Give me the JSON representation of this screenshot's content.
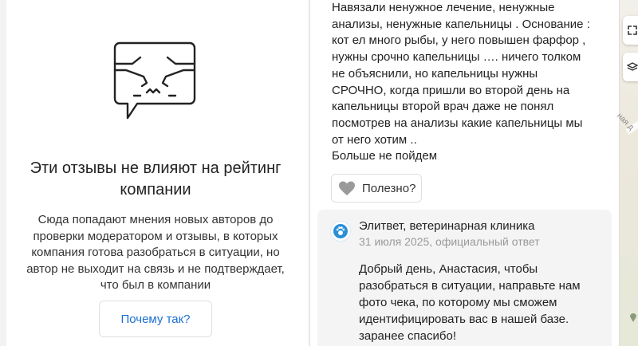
{
  "notice": {
    "title_lines": [
      "Эти отзывы не влияют на рейтинг",
      "компании"
    ],
    "body_lines": [
      "Сюда попадают мнения новых авторов до",
      "проверки модератором и отзывы, в которых",
      "компания готова разобраться в ситуации, но",
      "автор не выходит на связь и не подтверждает,",
      "что был в компании"
    ],
    "why_button": "Почему так?"
  },
  "review": {
    "text_lines": [
      "Навязали ненужное лечение, ненужные",
      "анализы, ненужные капельницы . Основание :",
      "кот ел много рыбы, у него повышен фарфор ,",
      "нужны срочно капельницы …. ничего толком",
      "не объяснили, но капельницы нужны",
      "СРОЧНО, когда пришли во второй день на",
      "капельницы второй врач даже не понял",
      "посмотрев на анализы какие капельницы мы",
      "от него хотим ..",
      "Больше не пойдем"
    ],
    "helpful_button": "Полезно?"
  },
  "reply": {
    "author": "Элитвет, ветеринарная клиника",
    "meta": "31 июля 2025, официальный ответ",
    "text_lines": [
      "Добрый день, Анастасия, чтобы",
      "разобраться в ситуации, направьте нам",
      "фото чека, по которому мы сможем",
      "идентифицировать вас в нашей базе.",
      "заранее спасибо!"
    ]
  },
  "map": {
    "street_label": "ная д"
  },
  "colors": {
    "accent": "#1a6fd4",
    "meta": "#999999",
    "reply_bg": "#f4f4f4"
  },
  "icons": {
    "illustration": "speech-bubble-faces-illustration",
    "helpful": "heart-icon",
    "reply_avatar": "clinic-logo-icon",
    "map_expand": "expand-icon",
    "map_layers": "layers-icon"
  }
}
